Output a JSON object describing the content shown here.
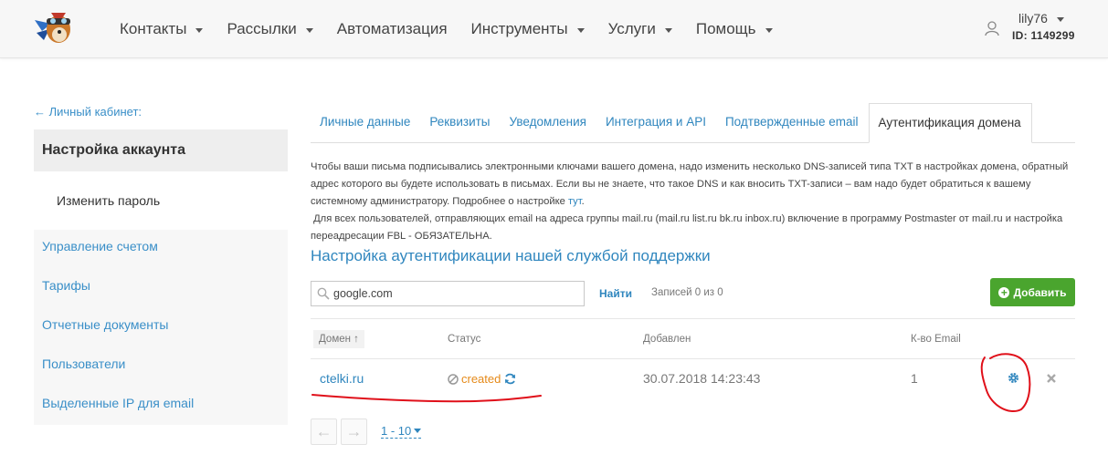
{
  "header": {
    "nav": [
      {
        "label": "Контакты",
        "has_caret": true
      },
      {
        "label": "Рассылки",
        "has_caret": true
      },
      {
        "label": "Автоматизация",
        "has_caret": false
      },
      {
        "label": "Инструменты",
        "has_caret": true
      },
      {
        "label": "Услуги",
        "has_caret": true
      },
      {
        "label": "Помощь",
        "has_caret": true
      }
    ],
    "user": {
      "name": "lily76",
      "id": "ID: 1149299"
    }
  },
  "sidebar": {
    "back_label": "← Личный кабинет:",
    "title": "Настройка аккаунта",
    "sub_item": "Изменить пароль",
    "items": [
      "Управление счетом",
      "Тарифы",
      "Отчетные документы",
      "Пользователи",
      "Выделенные IP для email"
    ]
  },
  "tabs": [
    "Личные данные",
    "Реквизиты",
    "Уведомления",
    "Интеграция и API",
    "Подтвержденные email",
    "Аутентификация домена"
  ],
  "active_tab": 5,
  "info": {
    "p1": "Чтобы ваши письма подписывались электронными ключами вашего домена, надо изменить несколько DNS-записей типа TXT в настройках домена, обратный адрес которого вы будете использовать в письмах. Если вы не знаете, что такое DNS и как вносить TXT-записи – вам надо будет обратиться к вашему системному администратору. Подробнее о настройке",
    "p1_link": "тут",
    "p2": "Для всех пользователей, отправляющих email на адреса группы mail.ru (mail.ru list.ru bk.ru inbox.ru) включение в программу Postmaster от mail.ru и настройка переадресации FBL - ОБЯЗАТЕЛЬНА."
  },
  "section_title": "Настройка аутентификации нашей службой поддержки",
  "search": {
    "value": "google.com",
    "button": "Найти",
    "records": "Записей 0 из 0"
  },
  "add_button": "Добавить",
  "table": {
    "headers": {
      "domain": "Домен ↑",
      "status": "Статус",
      "added": "Добавлен",
      "count": "К-во Email"
    },
    "rows": [
      {
        "domain": "ctelki.ru",
        "status": "created",
        "added": "30.07.2018 14:23:43",
        "count": "1"
      }
    ]
  },
  "pagination": {
    "range": "1 - 10"
  },
  "colors": {
    "link": "#2f86be",
    "accent_green": "#4aa52e",
    "status_orange": "#e58a1a",
    "annotation_red": "#e0101a"
  }
}
